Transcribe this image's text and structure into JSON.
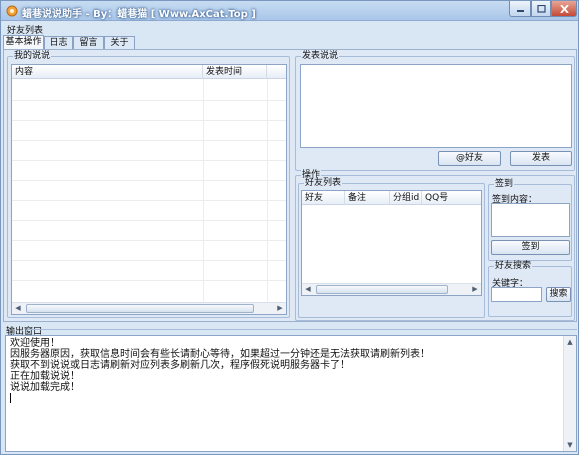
{
  "window": {
    "title": "蜡巷说说助手 - By：蜡巷猫 [ Www.AxCat.Top ]"
  },
  "menu": {
    "friends_list": "好友列表"
  },
  "tabs": [
    "基本操作",
    "日志",
    "留言",
    "关于"
  ],
  "my_shuoshuo": {
    "group_label": "我的说说",
    "columns": [
      "内容",
      "发表时间"
    ]
  },
  "post_shuoshuo": {
    "group_label": "发表说说",
    "at_friend_button": "@好友",
    "publish_button": "发表"
  },
  "operations": {
    "group_label": "操作",
    "friends_group_label": "好友列表",
    "friend_columns": [
      "好友",
      "备注",
      "分组id",
      "QQ号"
    ],
    "signin": {
      "group_label": "签到",
      "content_label": "签到内容：",
      "button": "签到"
    },
    "friend_search": {
      "group_label": "好友搜索",
      "keyword_label": "关键字：",
      "button": "搜索"
    }
  },
  "output": {
    "label": "输出窗口",
    "lines": [
      "欢迎使用！",
      "因服务器原因，获取信息时间会有些长请耐心等待，如果超过一分钟还是无法获取请刷新列表！",
      "获取不到说说或日志请刷新对应列表多刷新几次，程序假死说明服务器卡了！",
      "正在加载说说！",
      "说说加载完成！"
    ]
  },
  "colors": {
    "window_background": "#d9e6f4",
    "title_gradient_top": "#c7dcf2",
    "close_button": "#c44a36"
  }
}
